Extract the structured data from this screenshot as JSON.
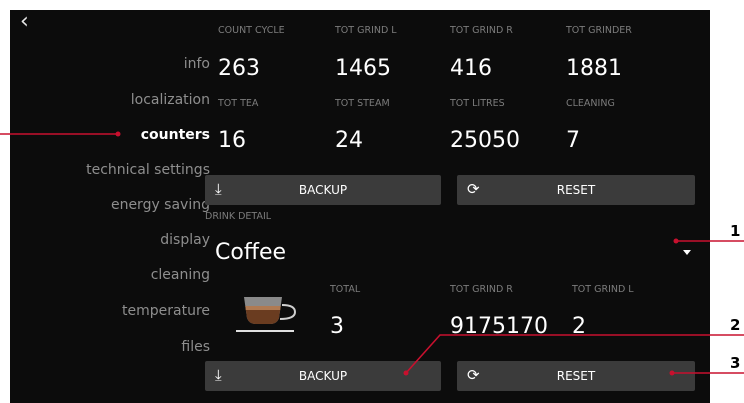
{
  "nav": {
    "back_icon": "chevron-left-icon",
    "items": [
      "info",
      "localization",
      "counters",
      "technical settings",
      "energy saving",
      "display",
      "cleaning",
      "temperature",
      "files"
    ],
    "active_index": 2
  },
  "counters": {
    "row1": [
      {
        "label": "COUNT CYCLE",
        "value": "263"
      },
      {
        "label": "TOT GRIND L",
        "value": "1465"
      },
      {
        "label": "TOT GRIND R",
        "value": "416"
      },
      {
        "label": "TOT GRINDER",
        "value": "1881"
      }
    ],
    "row2": [
      {
        "label": "TOT TEA",
        "value": "16"
      },
      {
        "label": "TOT STEAM",
        "value": "24"
      },
      {
        "label": "TOT LITRES",
        "value": "25050"
      },
      {
        "label": "CLEANING",
        "value": "7"
      }
    ],
    "backup_label": "BACKUP",
    "reset_label": "RESET"
  },
  "drink_detail": {
    "label": "DRINK DETAIL",
    "selected": "Coffee",
    "cup_icon": "coffee-cup-icon",
    "stats": [
      {
        "label": "TOTAL",
        "value": "3"
      },
      {
        "label": "TOT GRIND R",
        "value": "9175170"
      },
      {
        "label": "TOT GRIND L",
        "value": "2"
      }
    ],
    "backup_label": "BACKUP",
    "reset_label": "RESET"
  },
  "callouts": [
    "1",
    "2",
    "3"
  ],
  "colors": {
    "background": "#0c0c0c",
    "button": "#3b3b3b",
    "callout_line": "#c8102e"
  }
}
